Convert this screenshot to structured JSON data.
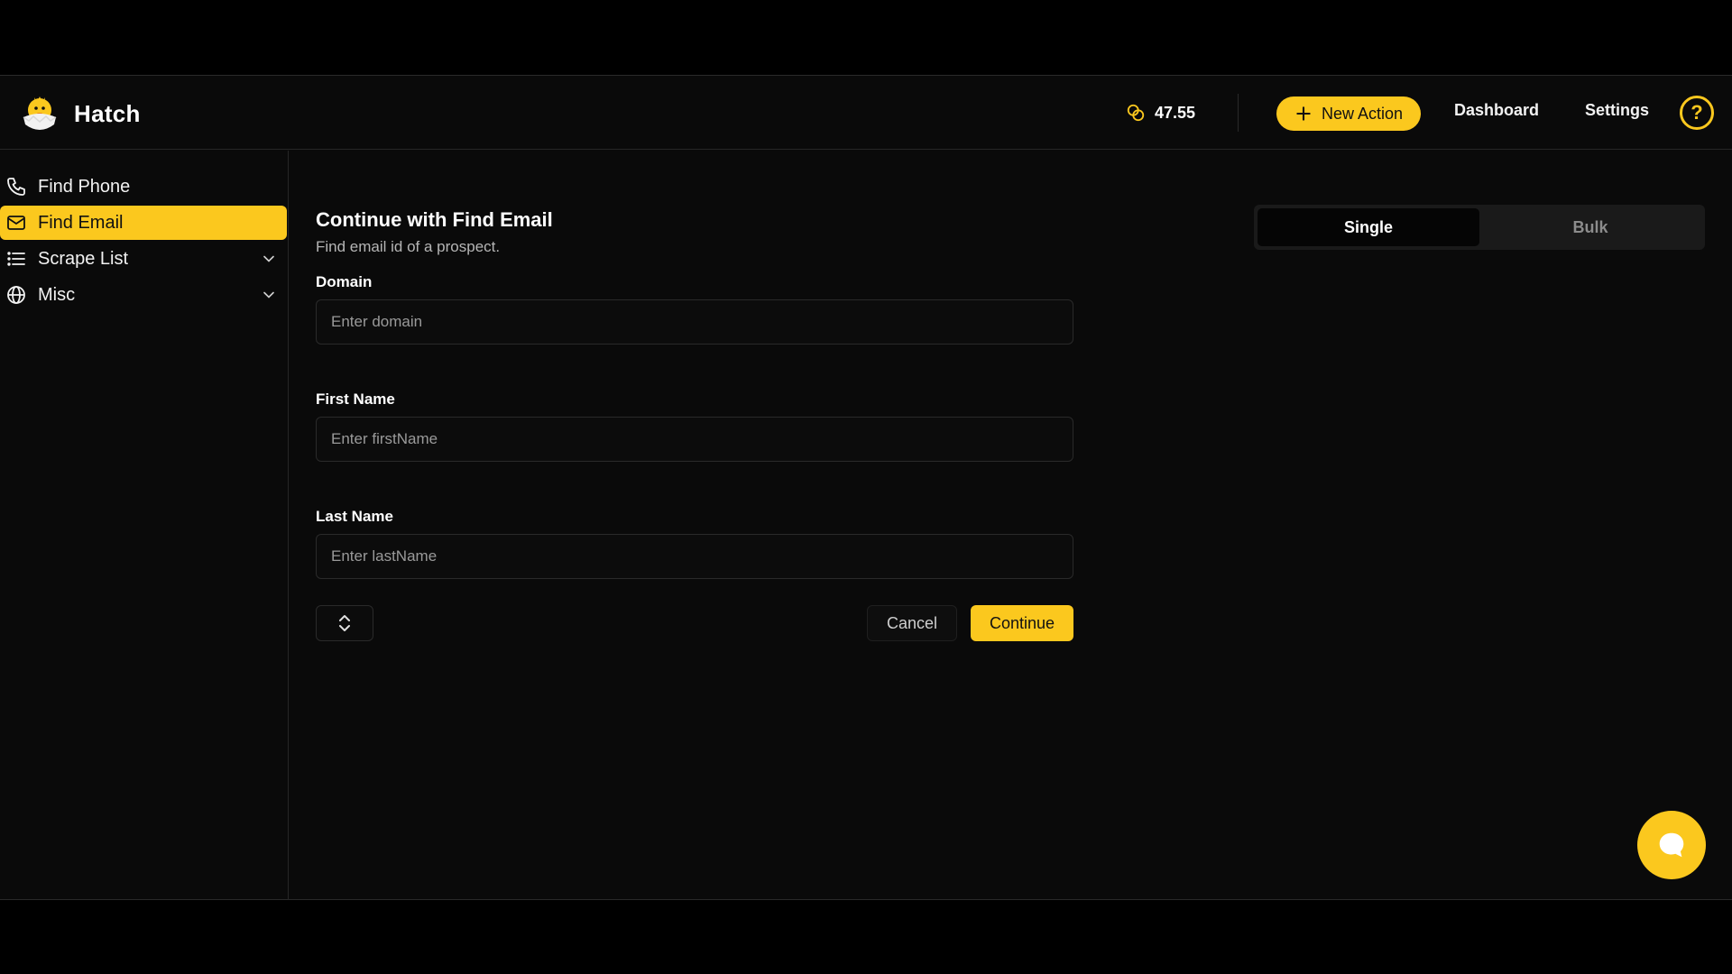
{
  "app": {
    "name": "Hatch"
  },
  "header": {
    "credits": "47.55",
    "new_action_label": "New Action",
    "nav": {
      "dashboard": "Dashboard",
      "settings": "Settings"
    },
    "help_label": "?"
  },
  "sidebar": {
    "items": [
      {
        "label": "Find Phone",
        "icon": "phone-icon",
        "active": false
      },
      {
        "label": "Find Email",
        "icon": "mail-icon",
        "active": true
      },
      {
        "label": "Scrape List",
        "icon": "list-icon",
        "active": false,
        "expandable": true
      },
      {
        "label": "Misc",
        "icon": "globe-icon",
        "active": false,
        "expandable": true
      }
    ]
  },
  "form": {
    "title": "Continue with Find Email",
    "subtitle": "Find email id of a prospect.",
    "fields": [
      {
        "label": "Domain",
        "placeholder": "Enter domain",
        "value": ""
      },
      {
        "label": "First Name",
        "placeholder": "Enter firstName",
        "value": ""
      },
      {
        "label": "Last Name",
        "placeholder": "Enter lastName",
        "value": ""
      }
    ],
    "cancel_label": "Cancel",
    "continue_label": "Continue"
  },
  "mode_toggle": {
    "options": [
      "Single",
      "Bulk"
    ],
    "selected": "Single"
  },
  "colors": {
    "accent": "#fbc81e",
    "background": "#0a0a0a",
    "border": "#262626"
  }
}
